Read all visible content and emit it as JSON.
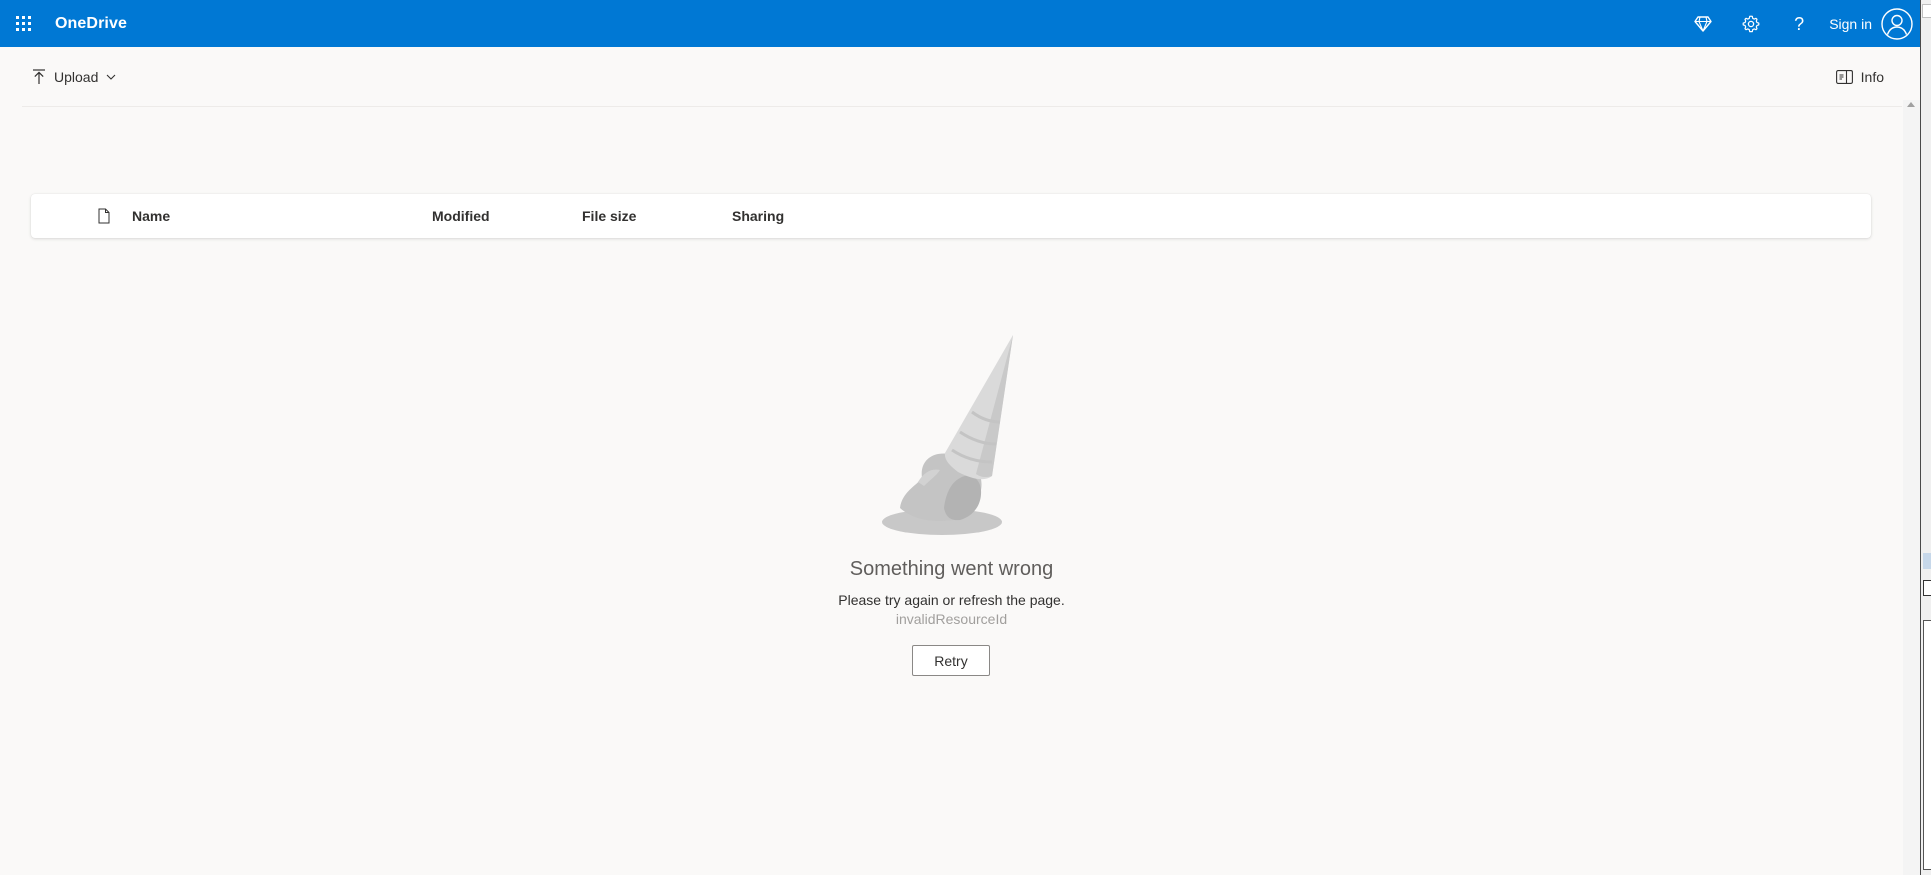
{
  "header": {
    "app_name": "OneDrive",
    "launcher_icon": "app-launcher-waffle-icon",
    "premium_icon": "diamond-icon",
    "settings_icon": "gear-icon",
    "help_symbol": "?",
    "sign_in_label": "Sign in",
    "avatar_icon": "person-icon",
    "bar_color": "#0078d4"
  },
  "commandbar": {
    "upload_label": "Upload",
    "upload_icon": "upload-arrow-icon",
    "info_label": "Info",
    "info_icon": "info-pane-icon"
  },
  "list": {
    "type_column_icon": "document-icon",
    "columns": [
      "Name",
      "Modified",
      "File size",
      "Sharing"
    ]
  },
  "error": {
    "illustration": "melted-ice-cream-icon",
    "title": "Something went wrong",
    "message": "Please try again or refresh the page.",
    "code": "invalidResourceId",
    "retry_label": "Retry"
  }
}
